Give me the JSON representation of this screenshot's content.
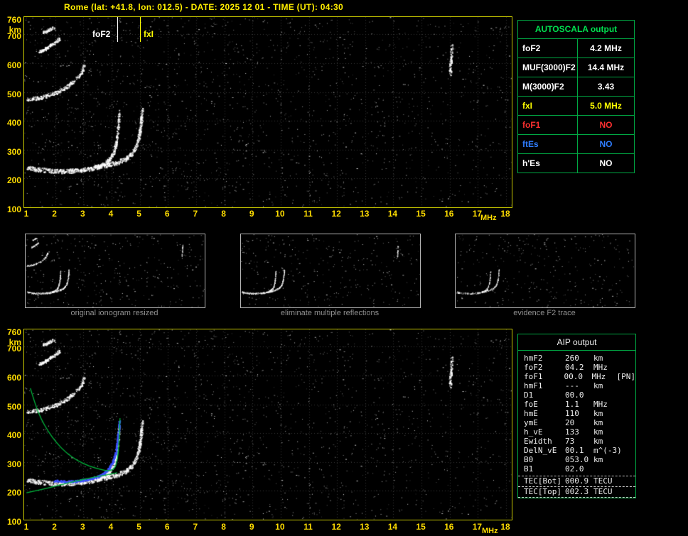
{
  "title": "Rome (lat: +41.8, lon: 012.5) - DATE: 2025 12 01 - TIME (UT): 04:30",
  "colors": {
    "accent_yellow": "#ffee00",
    "axis_yellow": "#ffdd00",
    "frame_yellow": "#c9c900",
    "table_green": "#00a843",
    "header_green": "#00e050",
    "status_red": "#ff3030",
    "status_blue": "#2f7dff",
    "white": "#ffffff",
    "caption_gray": "#8f8f8f",
    "profile_green": "#00b83c",
    "restored_blue": "#3c50ff"
  },
  "ionogram": {
    "x_ticks": [
      1,
      2,
      3,
      4,
      5,
      6,
      7,
      8,
      9,
      10,
      11,
      12,
      13,
      14,
      15,
      16,
      17,
      18
    ],
    "x_unit": "MHz",
    "y_ticks": [
      760,
      700,
      600,
      500,
      400,
      300,
      200,
      100
    ],
    "y_unit": "km",
    "markers": {
      "fof2": {
        "label": "foF2",
        "mhz": 4.2
      },
      "fxi": {
        "label": "fxI",
        "mhz": 5.0
      }
    }
  },
  "autoscala": {
    "header": "AUTOSCALA output",
    "rows": [
      {
        "label": "foF2",
        "value": "4.2 MHz",
        "color": "#ffffff"
      },
      {
        "label": "MUF(3000)F2",
        "value": "14.4 MHz",
        "color": "#ffffff"
      },
      {
        "label": "M(3000)F2",
        "value": "3.43",
        "color": "#ffffff"
      },
      {
        "label": "fxI",
        "value": "5.0 MHz",
        "color": "#ffff00"
      },
      {
        "label": "foF1",
        "value": "NO",
        "color": "#ff3030"
      },
      {
        "label": "ftEs",
        "value": "NO",
        "color": "#2f7dff"
      },
      {
        "label": "h'Es",
        "value": "NO",
        "color": "#ffffff"
      }
    ]
  },
  "panels": [
    {
      "caption": "original ionogram resized"
    },
    {
      "caption": "eliminate multiple reflections"
    },
    {
      "caption": "evidence F2 trace"
    }
  ],
  "aip": {
    "header": "AIP output",
    "rows": [
      {
        "label": "hmF2",
        "value": "260",
        "unit": "km",
        "extra": ""
      },
      {
        "label": "foF2",
        "value": "04.2",
        "unit": "MHz",
        "extra": ""
      },
      {
        "label": "foF1",
        "value": "00.0",
        "unit": "MHz",
        "extra": "[PN]"
      },
      {
        "label": "hmF1",
        "value": "---",
        "unit": "km",
        "extra": ""
      },
      {
        "label": "D1",
        "value": "00.0",
        "unit": "",
        "extra": ""
      },
      {
        "label": "foE",
        "value": "1.1",
        "unit": "MHz",
        "extra": ""
      },
      {
        "label": "hmE",
        "value": "110",
        "unit": "km",
        "extra": ""
      },
      {
        "label": "ymE",
        "value": "20",
        "unit": "km",
        "extra": ""
      },
      {
        "label": "h_vE",
        "value": "133",
        "unit": "km",
        "extra": ""
      },
      {
        "label": "Ewidth",
        "value": "73",
        "unit": "km",
        "extra": ""
      },
      {
        "label": "DelN_vE",
        "value": "00.1",
        "unit": "m^(-3)",
        "extra": ""
      },
      {
        "label": "B0",
        "value": "053.0",
        "unit": "km",
        "extra": ""
      },
      {
        "label": "B1",
        "value": "02.0",
        "unit": "",
        "extra": ""
      }
    ],
    "tec_rows": [
      {
        "label": "TEC[Bot]",
        "value": "000.9",
        "unit": "TECU"
      },
      {
        "label": "TEC[Top]",
        "value": "002.3",
        "unit": "TECU"
      }
    ]
  },
  "chart_data": {
    "type": "scatter",
    "title": "Rome ionogram 2025 12 01 04:30 UT",
    "xlabel": "MHz",
    "ylabel": "km",
    "xlim": [
      1,
      18
    ],
    "ylim": [
      100,
      760
    ],
    "grid": true,
    "scaled_values": {
      "foF2_MHz": 4.2,
      "fxI_MHz": 5.0,
      "MUF3000F2_MHz": 14.4,
      "M3000F2": 3.43,
      "foF1": "NO",
      "ftEs": "NO",
      "hEs": "NO"
    },
    "traces": [
      {
        "id": "F-trace-O",
        "w": 6,
        "n": 680,
        "pts": [
          [
            1.0,
            238
          ],
          [
            1.3,
            233
          ],
          [
            1.7,
            229
          ],
          [
            2.1,
            227
          ],
          [
            2.5,
            227
          ],
          [
            2.9,
            230
          ],
          [
            3.2,
            234
          ],
          [
            3.5,
            241
          ],
          [
            3.75,
            252
          ],
          [
            3.95,
            270
          ],
          [
            4.08,
            295
          ],
          [
            4.17,
            330
          ],
          [
            4.22,
            375
          ],
          [
            4.26,
            432
          ]
        ]
      },
      {
        "id": "F-trace-X",
        "w": 6,
        "n": 430,
        "pts": [
          [
            3.4,
            240
          ],
          [
            3.8,
            247
          ],
          [
            4.2,
            257
          ],
          [
            4.5,
            270
          ],
          [
            4.72,
            288
          ],
          [
            4.88,
            315
          ],
          [
            4.98,
            355
          ],
          [
            5.04,
            400
          ],
          [
            5.08,
            445
          ]
        ]
      },
      {
        "id": "multiple-2F",
        "w": 5,
        "n": 300,
        "pts": [
          [
            1.0,
            476
          ],
          [
            1.35,
            480
          ],
          [
            1.7,
            488
          ],
          [
            2.05,
            500
          ],
          [
            2.4,
            518
          ],
          [
            2.7,
            542
          ],
          [
            2.9,
            566
          ],
          [
            3.02,
            592
          ]
        ]
      },
      {
        "id": "multiple-3F",
        "w": 4,
        "n": 120,
        "pts": [
          [
            1.4,
            640
          ],
          [
            1.65,
            652
          ],
          [
            1.9,
            668
          ],
          [
            2.15,
            686
          ]
        ]
      },
      {
        "id": "multiple-4F",
        "w": 4,
        "n": 60,
        "pts": [
          [
            1.55,
            706
          ],
          [
            1.75,
            716
          ],
          [
            1.95,
            726
          ]
        ]
      },
      {
        "id": "interference-16MHz",
        "w": 3,
        "n": 80,
        "pts": [
          [
            16.0,
            560
          ],
          [
            16.03,
            615
          ],
          [
            16.06,
            665
          ]
        ]
      }
    ],
    "restored_trace_blue": [
      [
        1.95,
        236
      ],
      [
        2.3,
        234
      ],
      [
        2.6,
        234
      ],
      [
        2.9,
        237
      ],
      [
        3.2,
        242
      ],
      [
        3.5,
        250
      ],
      [
        3.72,
        261
      ],
      [
        3.9,
        278
      ],
      [
        4.04,
        302
      ],
      [
        4.14,
        335
      ],
      [
        4.2,
        375
      ],
      [
        4.25,
        420
      ],
      [
        4.27,
        442
      ]
    ],
    "virtual_trace_green": [
      [
        1.12,
        556
      ],
      [
        1.3,
        497
      ],
      [
        1.5,
        449
      ],
      [
        1.75,
        406
      ],
      [
        2.05,
        366
      ],
      [
        2.4,
        331
      ],
      [
        2.8,
        304
      ],
      [
        3.2,
        286
      ],
      [
        3.6,
        274
      ],
      [
        3.95,
        268
      ],
      [
        4.15,
        281
      ],
      [
        4.24,
        330
      ],
      [
        4.28,
        400
      ],
      [
        4.3,
        452
      ]
    ],
    "profile_green": [
      [
        0.98,
        193
      ],
      [
        1.3,
        200
      ],
      [
        1.7,
        209
      ],
      [
        2.2,
        221
      ],
      [
        2.7,
        233
      ],
      [
        3.2,
        244
      ],
      [
        3.7,
        253
      ],
      [
        4.2,
        263
      ]
    ]
  }
}
